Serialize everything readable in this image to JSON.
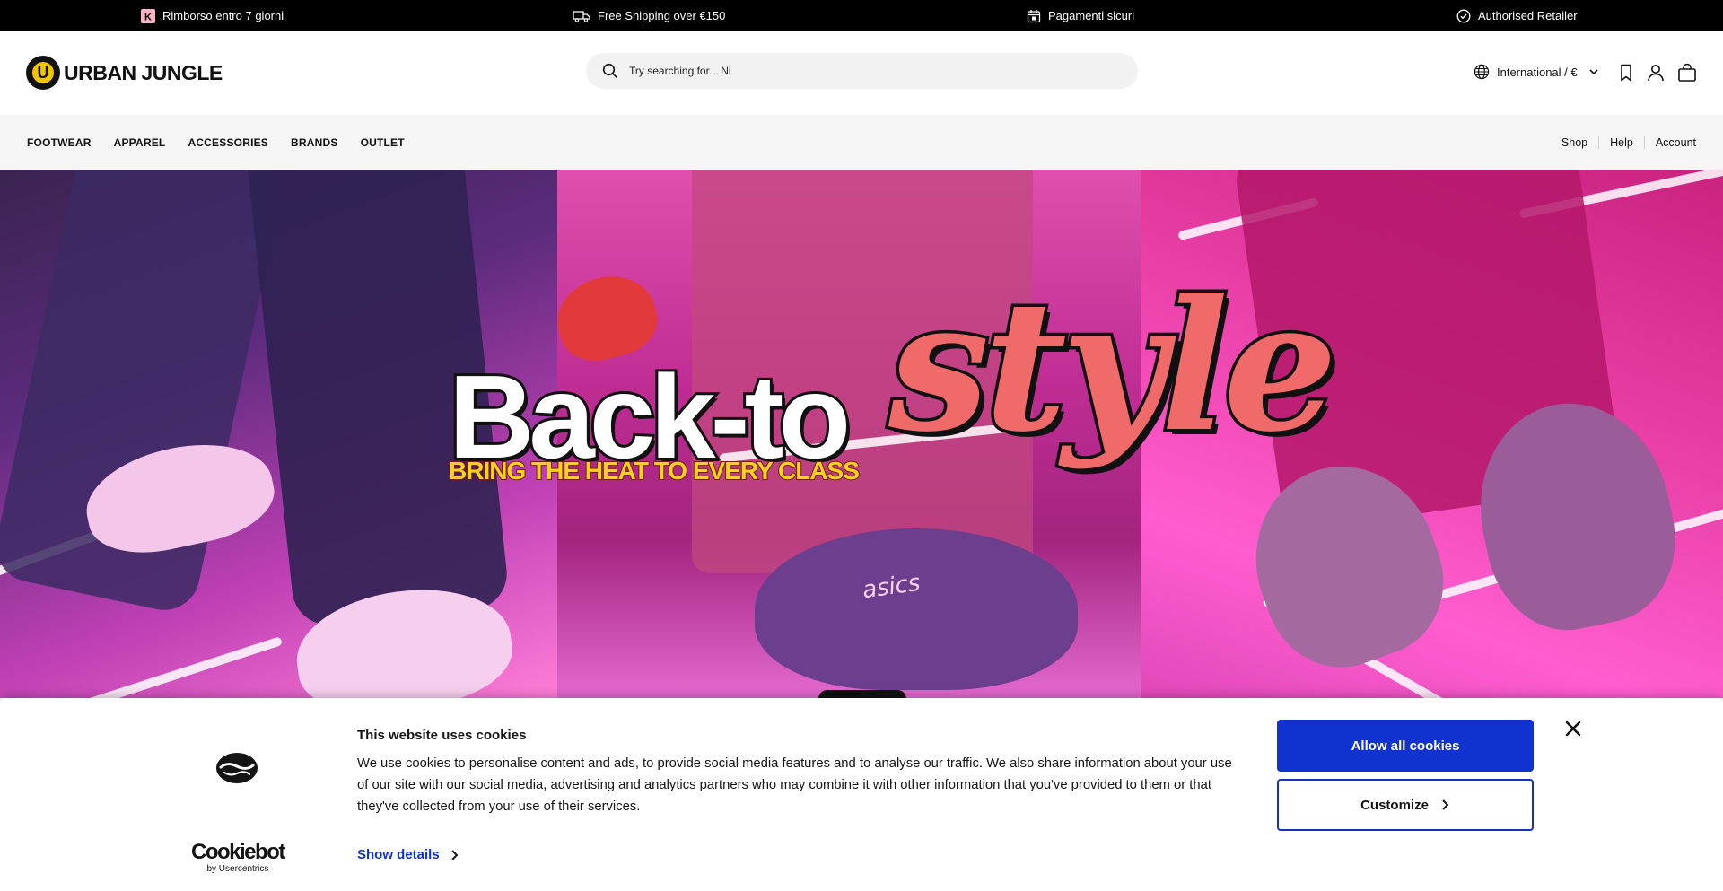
{
  "announcements": [
    {
      "label": "Rimborso entro 7 giorni",
      "icon": "klarna-icon"
    },
    {
      "label": "Free Shipping over €150",
      "icon": "truck-icon"
    },
    {
      "label": "Pagamenti sicuri",
      "icon": "calendar-icon"
    },
    {
      "label": "Authorised Retailer",
      "icon": "check-circle-icon"
    }
  ],
  "header": {
    "logo_text": "URBAN JUNGLE",
    "logo_letter": "U",
    "search_placeholder": "Try searching for... Ni",
    "locale": "International / €",
    "icons": [
      "bookmark-icon",
      "user-icon",
      "bag-icon"
    ]
  },
  "nav": {
    "left": [
      "FOOTWEAR",
      "APPAREL",
      "ACCESSORIES",
      "BRANDS",
      "OUTLET"
    ],
    "right": [
      "Shop",
      "Help",
      "Account"
    ]
  },
  "hero": {
    "headline": "Back-to",
    "script_word": "style",
    "tagline": "BRING THE HEAT TO EVERY CLASS",
    "shoe_brand_text": "asics"
  },
  "cookie": {
    "title": "This website uses cookies",
    "body": "We use cookies to personalise content and ads, to provide social media features and to analyse our traffic. We also share information about your use of our site with our social media, advertising and analytics partners who may combine it with other information that you've provided to them or that they've collected from your use of their services.",
    "show_details": "Show details",
    "allow_all": "Allow all cookies",
    "customize": "Customize",
    "brand_main": "Cookiebot",
    "brand_sub": "by Usercentrics",
    "accent_color": "#1032cf"
  }
}
